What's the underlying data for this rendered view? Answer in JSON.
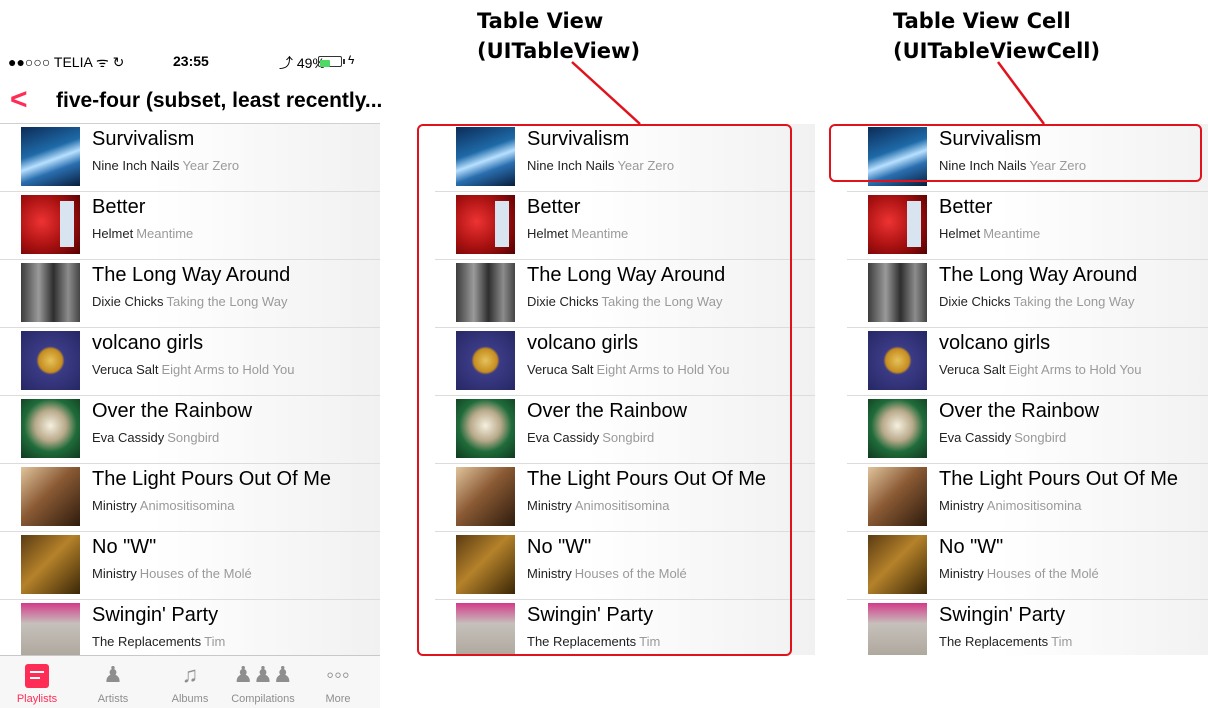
{
  "status_bar": {
    "carrier": "●●○○○ TELIA ᯤ ↻",
    "time": "23:55",
    "battery": "⤴ 49%",
    "battery_level": 0.49,
    "charge_icon": "bolt-icon"
  },
  "nav": {
    "back_label": "<",
    "title": "five-four (subset, least recently..."
  },
  "tracks": [
    {
      "title": "Survivalism",
      "artist": "Nine Inch Nails",
      "album": "Year Zero"
    },
    {
      "title": "Better",
      "artist": "Helmet",
      "album": "Meantime"
    },
    {
      "title": "The Long Way Around",
      "artist": "Dixie Chicks",
      "album": "Taking the Long Way"
    },
    {
      "title": "volcano girls",
      "artist": "Veruca Salt",
      "album": "Eight Arms to Hold You"
    },
    {
      "title": "Over the Rainbow",
      "artist": "Eva Cassidy",
      "album": "Songbird"
    },
    {
      "title": "The Light Pours Out Of Me",
      "artist": "Ministry",
      "album": "Animositisomina"
    },
    {
      "title": "No \"W\"",
      "artist": "Ministry",
      "album": "Houses of the Molé"
    },
    {
      "title": "Swingin' Party",
      "artist": "The Replacements",
      "album": "Tim"
    }
  ],
  "tab_bar": {
    "items": [
      {
        "label": "Playlists",
        "icon": "playlist-icon",
        "active": true
      },
      {
        "label": "Artists",
        "icon": "artist-icon",
        "active": false
      },
      {
        "label": "Albums",
        "icon": "album-icon",
        "active": false
      },
      {
        "label": "Compilations",
        "icon": "compilations-icon",
        "active": false
      },
      {
        "label": "More",
        "icon": "more-icon",
        "active": false
      }
    ]
  },
  "annotations": {
    "table_view": {
      "line1": "Table View",
      "line2": "(UITableView)"
    },
    "table_view_cell": {
      "line1": "Table View Cell",
      "line2": "(UITableViewCell)"
    }
  },
  "colors": {
    "accent": "#ff2d55",
    "annotation": "#e0121c",
    "subtitle_gray": "#9a9a9a"
  }
}
